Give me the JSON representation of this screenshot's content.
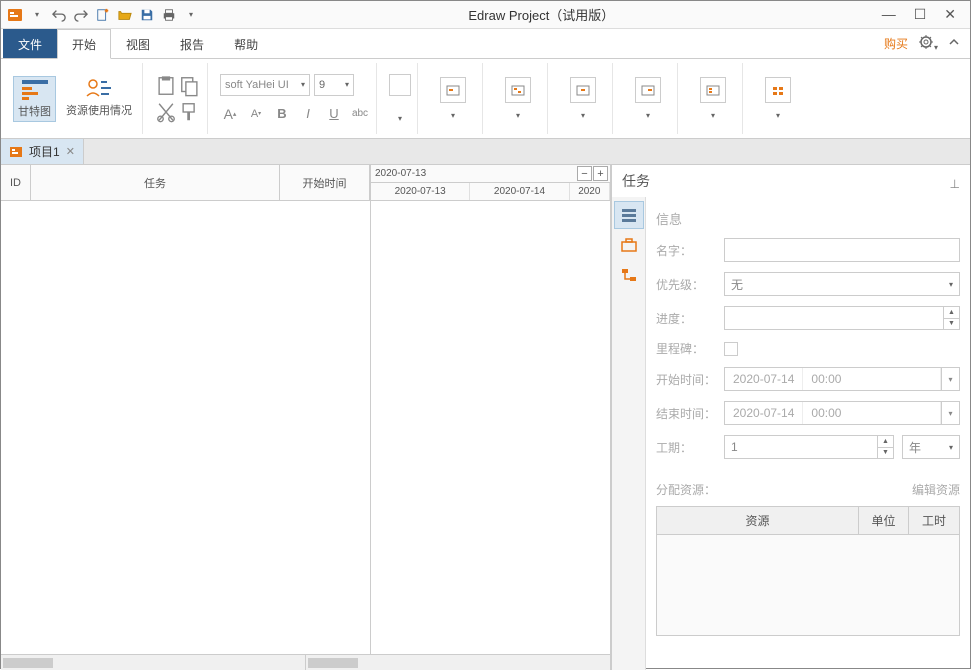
{
  "app": {
    "title": "Edraw Project（试用版）"
  },
  "menu": {
    "file": "文件",
    "start": "开始",
    "view": "视图",
    "report": "报告",
    "help": "帮助",
    "buy": "购买"
  },
  "ribbon": {
    "gantt": "甘特图",
    "resource_usage": "资源使用情况",
    "font_name": "soft YaHei UI",
    "font_size": "9"
  },
  "doc": {
    "tab1": "项目1"
  },
  "grid": {
    "id": "ID",
    "task": "任务",
    "start_time": "开始时间",
    "timeline_range": "2020-07-13",
    "dates": [
      "2020-07-13",
      "2020-07-14",
      "2020"
    ]
  },
  "task_panel": {
    "title": "任务",
    "info": "信息",
    "name_label": "名字：",
    "priority_label": "优先级：",
    "priority_value": "无",
    "progress_label": "进度：",
    "milestone_label": "里程碑：",
    "start_label": "开始时间：",
    "start_date": "2020-07-14",
    "start_time": "00:00",
    "end_label": "结束时间：",
    "end_date": "2020-07-14",
    "end_time": "00:00",
    "duration_label": "工期：",
    "duration_value": "1",
    "duration_unit": "年",
    "resources_label": "分配资源：",
    "edit_resources": "编辑资源",
    "res_col1": "资源",
    "res_col2": "单位",
    "res_col3": "工时"
  }
}
